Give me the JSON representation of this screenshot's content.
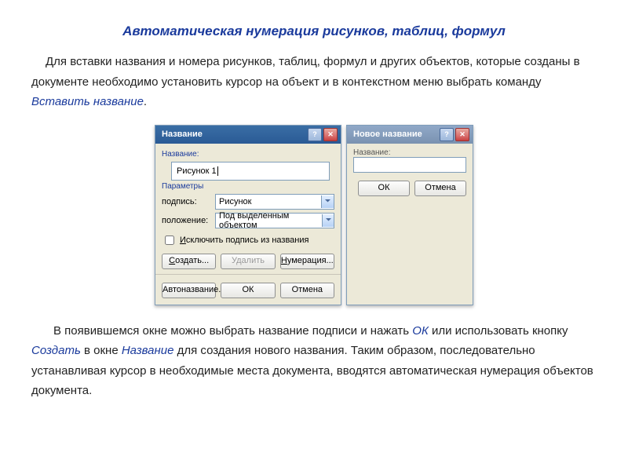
{
  "title": "Автоматическая нумерация рисунков, таблиц, формул",
  "para1_a": "Для вставки названия и номера рисунков, таблиц, формул и других объектов, которые созданы в документе необходимо установить курсор на объект и в контекстном меню выбрать команду ",
  "para1_em": "Вставить название",
  "para1_b": ".",
  "dlg1": {
    "title": "Название",
    "section_name": "Название:",
    "caption_value": "Рисунок 1",
    "section_params": "Параметры",
    "label_podpis": "подпись:",
    "combo_podpis": "Рисунок",
    "label_pos": "положение:",
    "combo_pos": "Под выделенным объектом",
    "chk_label_pre": "И",
    "chk_label_rest": "сключить подпись из названия",
    "btn_create": "Создать...",
    "btn_delete": "Удалить",
    "btn_num": "Нумерация...",
    "btn_auto": "Автоназвание...",
    "btn_ok": "ОК",
    "btn_cancel": "Отмена"
  },
  "dlg2": {
    "title": "Новое название",
    "label": "Название:",
    "btn_ok": "ОК",
    "btn_cancel": "Отмена"
  },
  "para2_a": "В появившемся окне можно выбрать название подписи и нажать ",
  "para2_ok": "ОК",
  "para2_b": " или использовать кнопку ",
  "para2_create": "Создать",
  "para2_c": " в окне ",
  "para2_name": "Название",
  "para2_d": " для создания нового названия. Таким образом, последовательно устанавливая курсор в необходимые места документа, вводятся  автоматическая нумерация объектов документа."
}
